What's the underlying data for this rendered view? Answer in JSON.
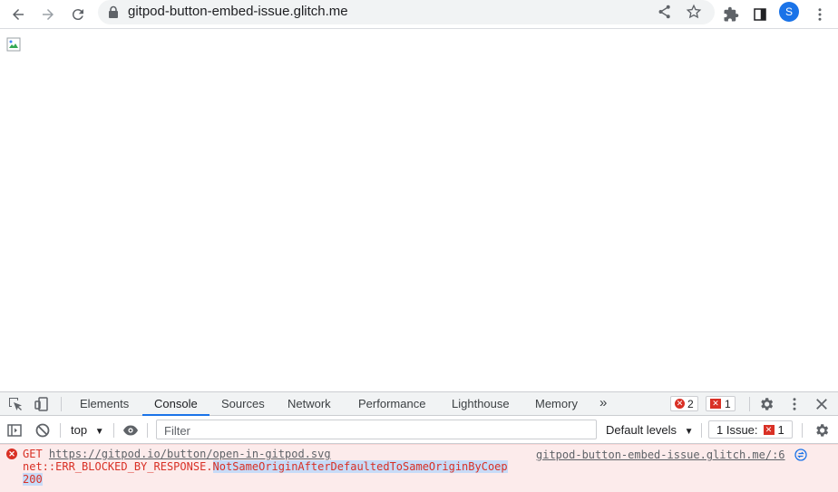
{
  "browser": {
    "url": "gitpod-button-embed-issue.glitch.me",
    "profile_initial": "S",
    "nav_icons": [
      "back-icon",
      "forward-icon",
      "reload-icon"
    ],
    "toolbar_icons": [
      "share-icon",
      "star-icon",
      "extensions-icon",
      "side-panel-icon"
    ]
  },
  "devtools": {
    "tabs": [
      {
        "label": "Elements"
      },
      {
        "label": "Console"
      },
      {
        "label": "Sources"
      },
      {
        "label": "Network"
      },
      {
        "label": "Performance"
      },
      {
        "label": "Lighthouse"
      },
      {
        "label": "Memory"
      }
    ],
    "active_tab": "Console",
    "error_count": "2",
    "issue_count": "1",
    "console": {
      "context": "top",
      "filter_placeholder": "Filter",
      "levels_label": "Default levels",
      "issues_label": "1 Issue:",
      "issues_count": "1"
    },
    "message": {
      "method": "GET",
      "url": "https://gitpod.io/button/open-in-gitpod.svg",
      "error_prefix": "net::ERR_BLOCKED_BY_RESPONSE.",
      "error_highlight": "NotSameOriginAfterDefaultedToSameOriginByCoep",
      "status": "200",
      "source": "gitpod-button-embed-issue.glitch.me/:6"
    }
  },
  "colors": {
    "accent": "#1a73e8",
    "error": "#d93025",
    "error_bg": "#fcebeb",
    "toolbar_bg": "#f1f3f4"
  }
}
